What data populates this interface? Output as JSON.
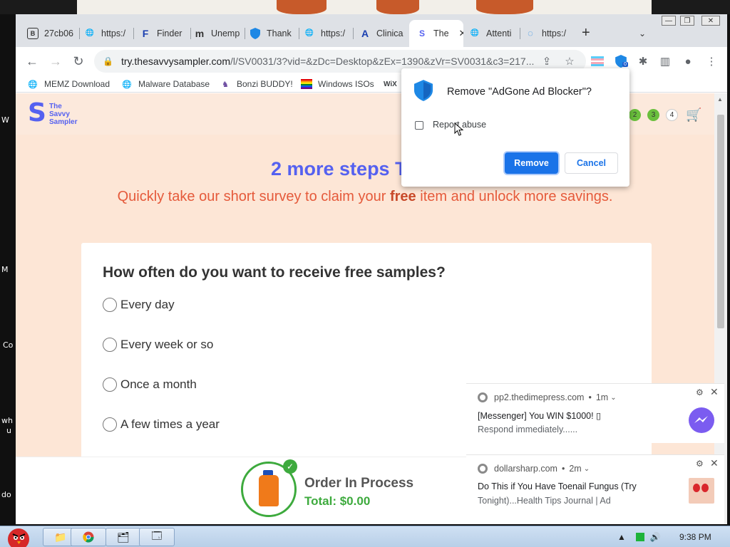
{
  "tabs": [
    {
      "title": "27cb06",
      "icon": "b-square-icon"
    },
    {
      "title": "https:/",
      "icon": "globe-icon"
    },
    {
      "title": "Finder",
      "icon": "f-letter-icon"
    },
    {
      "title": "Unemp",
      "icon": "m-letter-icon"
    },
    {
      "title": "Thank",
      "icon": "shield-icon"
    },
    {
      "title": "https:/",
      "icon": "globe-icon"
    },
    {
      "title": "Clinica",
      "icon": "a-letter-icon"
    },
    {
      "title": "The",
      "icon": "savvy-sampler-icon",
      "active": true
    },
    {
      "title": "Attenti",
      "icon": "globe-icon"
    },
    {
      "title": "https:/",
      "icon": "spinner-icon"
    }
  ],
  "url": {
    "host": "try.thesavvysampler.com",
    "path": "/l/SV0031/3?vid=&zDc=Desktop&zEx=1390&zVr=SV0031&c3=217..."
  },
  "extension_badge": "0",
  "bookmarks": [
    {
      "label": "MEMZ Download",
      "icon": "globe-icon"
    },
    {
      "label": "Malware Database",
      "icon": "globe-icon"
    },
    {
      "label": "Bonzi BUDDY!",
      "icon": "bonzi-icon"
    },
    {
      "label": "Windows ISOs",
      "icon": "windows-flag-icon"
    },
    {
      "label": "WiX",
      "icon": "wix-icon"
    }
  ],
  "site": {
    "logo_line1": "The",
    "logo_line2": "Savvy",
    "logo_line3": "Sampler",
    "steps": [
      "2",
      "3",
      "4"
    ],
    "headline": "2 more steps T",
    "subline_before": "Quickly take our short survey to claim your ",
    "subline_bold": "free",
    "subline_after": " item and unlock more savings.",
    "question": "How often do you want to receive free samples?",
    "options": [
      "Every day",
      "Every week or so",
      "Once a month",
      "A few times a year"
    ],
    "order_title": "Order In Process",
    "order_total": "Total: $0.00"
  },
  "dialog": {
    "title": "Remove \"AdGone Ad Blocker\"?",
    "checkbox_label": "Report abuse",
    "remove_label": "Remove",
    "cancel_label": "Cancel"
  },
  "notifications": [
    {
      "source": "pp2.thedimepress.com",
      "age": "1m",
      "title": "[Messenger] You WIN $1000! ▯",
      "body": "Respond immediately......"
    },
    {
      "source": "dollarsharp.com",
      "age": "2m",
      "title": "Do This if You Have Toenail Fungus (Try",
      "body": "Tonight)...Health Tips Journal | Ad"
    }
  ],
  "desktop_labels": [
    "W",
    "M",
    "Co",
    "wh",
    "u",
    "do"
  ],
  "taskbar": {
    "clock": "9:38 PM"
  },
  "colors": {
    "brand_blue": "#5561f0",
    "brand_orange": "#e55a3b",
    "page_bg": "#fde6d6",
    "order_green": "#3daa3d",
    "dialog_button": "#1a73e8"
  }
}
